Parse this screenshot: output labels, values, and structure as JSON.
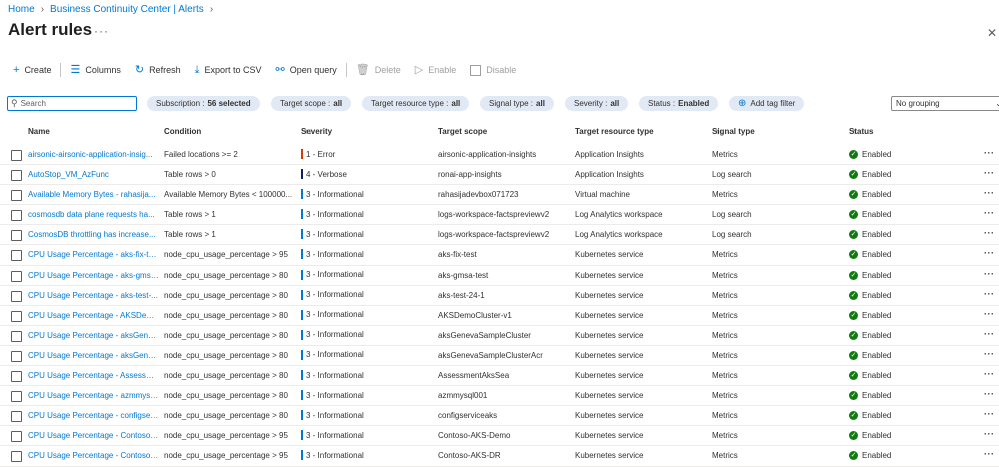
{
  "breadcrumb": {
    "home": "Home",
    "section": "Business Continuity Center | Alerts"
  },
  "page": {
    "title": "Alert rules",
    "more": "···",
    "close": "✕"
  },
  "toolbar": {
    "create": "Create",
    "columns": "Columns",
    "refresh": "Refresh",
    "export": "Export to CSV",
    "open_query": "Open query",
    "delete": "Delete",
    "enable": "Enable",
    "disable": "Disable"
  },
  "filters": {
    "search_placeholder": "Search",
    "subscription": {
      "label": "Subscription :",
      "value": "56 selected"
    },
    "target_scope": {
      "label": "Target scope :",
      "value": "all"
    },
    "target_resource_type": {
      "label": "Target resource type :",
      "value": "all"
    },
    "signal_type": {
      "label": "Signal type :",
      "value": "all"
    },
    "severity": {
      "label": "Severity :",
      "value": "all"
    },
    "status": {
      "label": "Status :",
      "value": "Enabled"
    },
    "add_tag_filter": "Add tag filter",
    "grouping": "No grouping"
  },
  "table": {
    "headers": {
      "name": "Name",
      "condition": "Condition",
      "severity": "Severity",
      "target_scope": "Target scope",
      "target_resource_type": "Target resource type",
      "signal_type": "Signal type",
      "status": "Status"
    },
    "sort_glyph": "↑↓",
    "severity_colors": {
      "1 - Error": "#d83b01",
      "4 - Verbose": "#0f1d69",
      "3 - Informational": "#0078d4"
    },
    "rows": [
      {
        "name": "airsonic-airsonic-application-insig...",
        "condition": "Failed locations >= 2",
        "severity": "1 - Error",
        "scope": "airsonic-application-insights",
        "rtype": "Application Insights",
        "signal": "Metrics",
        "status": "Enabled"
      },
      {
        "name": "AutoStop_VM_AzFunc",
        "condition": "Table rows > 0",
        "severity": "4 - Verbose",
        "scope": "ronai-app-insights",
        "rtype": "Application Insights",
        "signal": "Log search",
        "status": "Enabled"
      },
      {
        "name": "Available Memory Bytes - rahasija...",
        "condition": "Available Memory Bytes < 100000...",
        "severity": "3 - Informational",
        "scope": "rahasijadevbox071723",
        "rtype": "Virtual machine",
        "signal": "Metrics",
        "status": "Enabled"
      },
      {
        "name": "cosmosdb data plane requests ha...",
        "condition": "Table rows > 1",
        "severity": "3 - Informational",
        "scope": "logs-workspace-factspreviewv2",
        "rtype": "Log Analytics workspace",
        "signal": "Log search",
        "status": "Enabled"
      },
      {
        "name": "CosmosDB throttling has increase...",
        "condition": "Table rows > 1",
        "severity": "3 - Informational",
        "scope": "logs-workspace-factspreviewv2",
        "rtype": "Log Analytics workspace",
        "signal": "Log search",
        "status": "Enabled"
      },
      {
        "name": "CPU Usage Percentage - aks-fix-test",
        "condition": "node_cpu_usage_percentage > 95",
        "severity": "3 - Informational",
        "scope": "aks-fix-test",
        "rtype": "Kubernetes service",
        "signal": "Metrics",
        "status": "Enabled"
      },
      {
        "name": "CPU Usage Percentage - aks-gmsa...",
        "condition": "node_cpu_usage_percentage > 80",
        "severity": "3 - Informational",
        "scope": "aks-gmsa-test",
        "rtype": "Kubernetes service",
        "signal": "Metrics",
        "status": "Enabled"
      },
      {
        "name": "CPU Usage Percentage - aks-test-...",
        "condition": "node_cpu_usage_percentage > 80",
        "severity": "3 - Informational",
        "scope": "aks-test-24-1",
        "rtype": "Kubernetes service",
        "signal": "Metrics",
        "status": "Enabled"
      },
      {
        "name": "CPU Usage Percentage - AKSDem...",
        "condition": "node_cpu_usage_percentage > 80",
        "severity": "3 - Informational",
        "scope": "AKSDemoCluster-v1",
        "rtype": "Kubernetes service",
        "signal": "Metrics",
        "status": "Enabled"
      },
      {
        "name": "CPU Usage Percentage - aksGenev...",
        "condition": "node_cpu_usage_percentage > 80",
        "severity": "3 - Informational",
        "scope": "aksGenevaSampleCluster",
        "rtype": "Kubernetes service",
        "signal": "Metrics",
        "status": "Enabled"
      },
      {
        "name": "CPU Usage Percentage - aksGenev...",
        "condition": "node_cpu_usage_percentage > 80",
        "severity": "3 - Informational",
        "scope": "aksGenevaSampleClusterAcr",
        "rtype": "Kubernetes service",
        "signal": "Metrics",
        "status": "Enabled"
      },
      {
        "name": "CPU Usage Percentage - Assessme...",
        "condition": "node_cpu_usage_percentage > 80",
        "severity": "3 - Informational",
        "scope": "AssessmentAksSea",
        "rtype": "Kubernetes service",
        "signal": "Metrics",
        "status": "Enabled"
      },
      {
        "name": "CPU Usage Percentage - azmmysq...",
        "condition": "node_cpu_usage_percentage > 80",
        "severity": "3 - Informational",
        "scope": "azmmysql001",
        "rtype": "Kubernetes service",
        "signal": "Metrics",
        "status": "Enabled"
      },
      {
        "name": "CPU Usage Percentage - configser...",
        "condition": "node_cpu_usage_percentage > 80",
        "severity": "3 - Informational",
        "scope": "configserviceaks",
        "rtype": "Kubernetes service",
        "signal": "Metrics",
        "status": "Enabled"
      },
      {
        "name": "CPU Usage Percentage - Contoso-...",
        "condition": "node_cpu_usage_percentage > 95",
        "severity": "3 - Informational",
        "scope": "Contoso-AKS-Demo",
        "rtype": "Kubernetes service",
        "signal": "Metrics",
        "status": "Enabled"
      },
      {
        "name": "CPU Usage Percentage - Contoso-...",
        "condition": "node_cpu_usage_percentage > 95",
        "severity": "3 - Informational",
        "scope": "Contoso-AKS-DR",
        "rtype": "Kubernetes service",
        "signal": "Metrics",
        "status": "Enabled"
      }
    ]
  }
}
